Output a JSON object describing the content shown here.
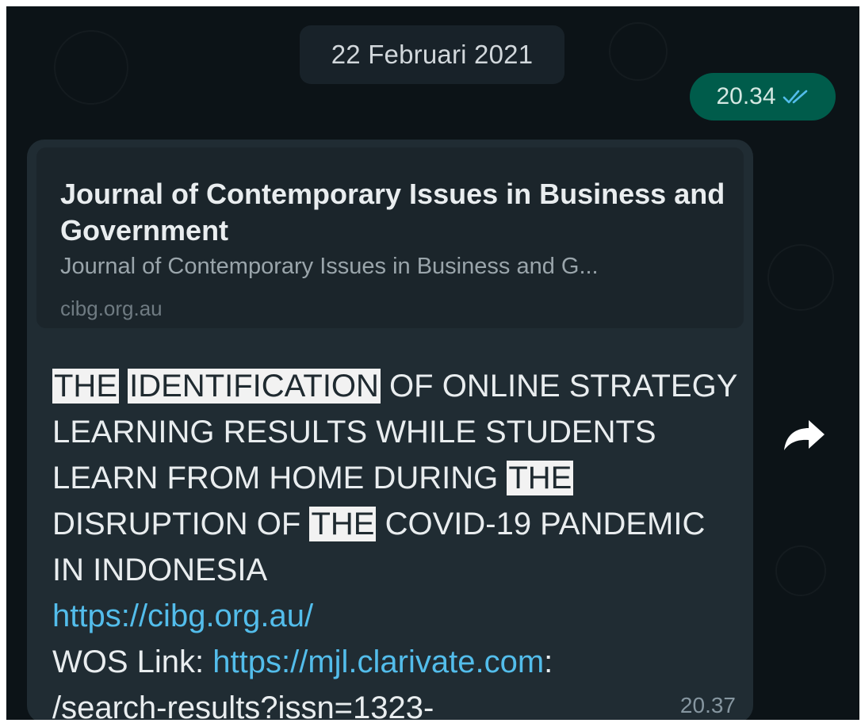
{
  "date_separator": "22 Februari 2021",
  "sent_message": {
    "time": "20.34",
    "status_icon": "double-check-icon"
  },
  "received_message": {
    "link_preview": {
      "title": "Journal of Contemporary Issues in Business and Government",
      "description": "Journal of Contemporary Issues in Business and G...",
      "domain": "cibg.org.au"
    },
    "text": {
      "w_the1": "THE",
      "w_identification": "IDENTIFICATION",
      "seg1": " OF ONLINE STRATEGY LEARNING RESULTS WHILE STUDENTS LEARN FROM HOME DURING ",
      "w_the2": "THE",
      "seg2": " DISRUPTION OF ",
      "w_the3": "THE",
      "seg3": " COVID-19 PANDEMIC IN INDONESIA",
      "link1": "https://cibg.org.au/",
      "wos_label": "WOS Link: ",
      "link2": "https://mjl.clarivate.com",
      "link2_suffix": ":",
      "line_end": "/search-results?issn=1323-"
    },
    "time": "20.37"
  },
  "forward_icon": "forward-arrow-icon",
  "colors": {
    "background": "#0c1317",
    "bubble": "#202c33",
    "sent_bubble": "#005c4b",
    "link": "#53bdeb",
    "highlight": "#f2f2f2"
  }
}
